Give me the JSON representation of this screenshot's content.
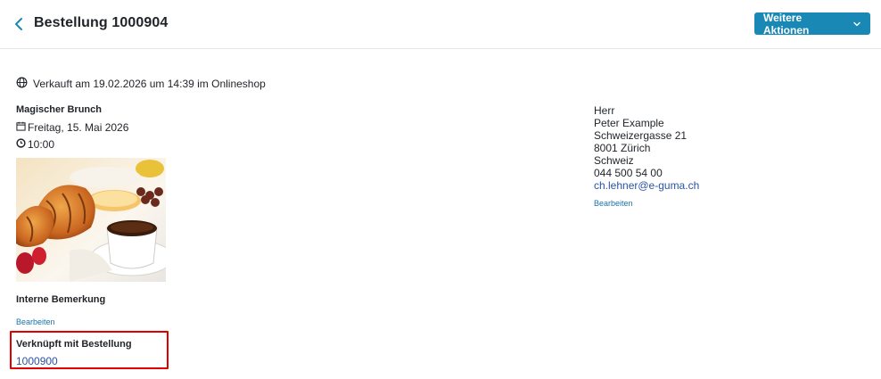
{
  "header": {
    "title": "Bestellung 1000904",
    "actions_label": "Weitere Aktionen"
  },
  "sale": {
    "text": "Verkauft am 19.02.2026 um 14:39 im Onlineshop"
  },
  "event": {
    "title": "Magischer Brunch",
    "date": "Freitag, 15. Mai 2026",
    "time": "10:00"
  },
  "internal_note": {
    "title": "Interne Bemerkung",
    "edit_label": "Bearbeiten"
  },
  "linked": {
    "title": "Verknüpft mit Bestellung",
    "order_number": "1000900"
  },
  "customer": {
    "salutation": "Herr",
    "name": "Peter Example",
    "street": "Schweizergasse 21",
    "city": "8001 Zürich",
    "country": "Schweiz",
    "phone": "044 500 54 00",
    "email": "ch.lehner@e-guma.ch",
    "edit_label": "Bearbeiten"
  },
  "colors": {
    "accent": "#1a88b5",
    "link": "#2b53a4",
    "highlight": "#e00000"
  }
}
